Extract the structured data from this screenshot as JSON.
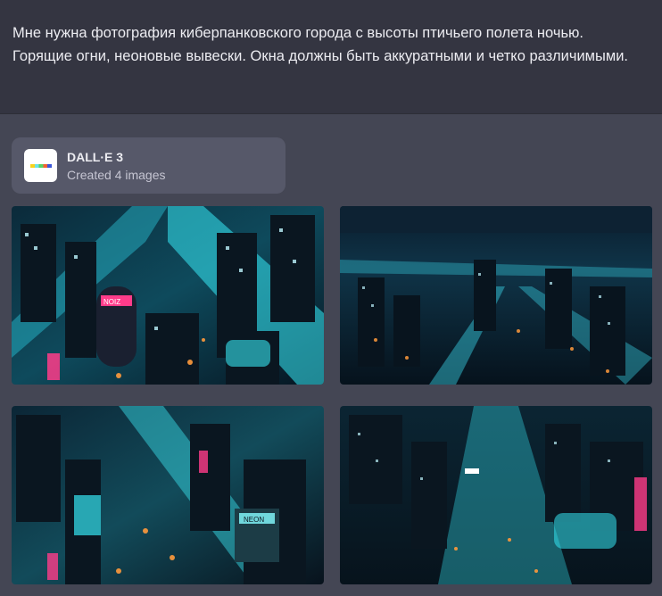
{
  "user_message": {
    "text": "Мне нужна фотография киберпанковского города с высоты птичьего полета ночью. Горящие огни, неоновые вывески. Окна должны быть аккуратными и четко различимыми."
  },
  "tool_card": {
    "name": "DALL·E 3",
    "status": "Created 4 images",
    "icon": "dalle-logo-icon"
  },
  "images": [
    {
      "label": "generated-image-1",
      "sign_text": "NOIZ"
    },
    {
      "label": "generated-image-2",
      "sign_text": ""
    },
    {
      "label": "generated-image-3",
      "sign_text": "NEON"
    },
    {
      "label": "generated-image-4",
      "sign_text": ""
    }
  ],
  "colors": {
    "background": "#444654",
    "user_bg": "#343541",
    "card_bg": "#565869",
    "neon_cyan": "#35e6f2",
    "neon_pink": "#ff3c8a",
    "neon_orange": "#ff9a3c"
  }
}
